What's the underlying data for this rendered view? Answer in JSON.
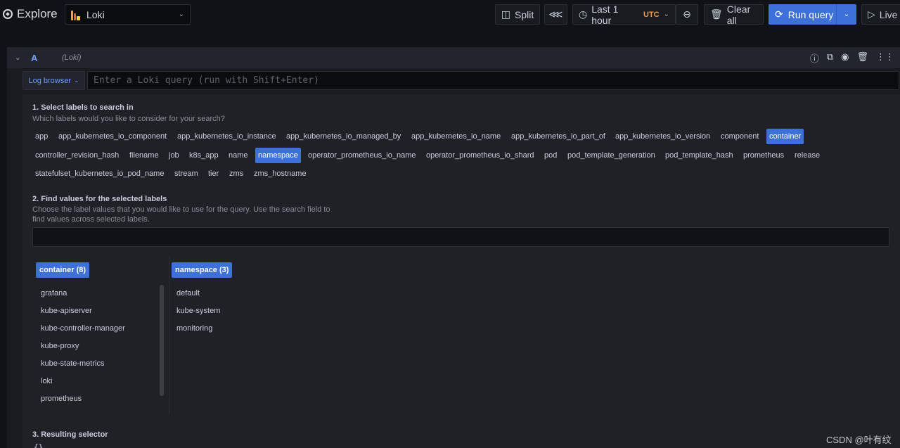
{
  "header": {
    "title": "Explore",
    "datasource": "Loki",
    "split_label": "Split",
    "time_range": "Last 1 hour",
    "timezone": "UTC",
    "clear_label": "Clear all",
    "run_label": "Run query",
    "live_label": "Live"
  },
  "query": {
    "ref_id": "A",
    "datasource_tag": "(Loki)",
    "log_browser_label": "Log browser",
    "placeholder": "Enter a Loki query (run with Shift+Enter)"
  },
  "step1": {
    "title": "1. Select labels to search in",
    "desc": "Which labels would you like to consider for your search?",
    "labels": [
      {
        "text": "app",
        "selected": false
      },
      {
        "text": "app_kubernetes_io_component",
        "selected": false
      },
      {
        "text": "app_kubernetes_io_instance",
        "selected": false
      },
      {
        "text": "app_kubernetes_io_managed_by",
        "selected": false
      },
      {
        "text": "app_kubernetes_io_name",
        "selected": false
      },
      {
        "text": "app_kubernetes_io_part_of",
        "selected": false
      },
      {
        "text": "app_kubernetes_io_version",
        "selected": false
      },
      {
        "text": "component",
        "selected": false
      },
      {
        "text": "container",
        "selected": true
      },
      {
        "text": "controller_revision_hash",
        "selected": false
      },
      {
        "text": "filename",
        "selected": false
      },
      {
        "text": "job",
        "selected": false
      },
      {
        "text": "k8s_app",
        "selected": false
      },
      {
        "text": "name",
        "selected": false
      },
      {
        "text": "namespace",
        "selected": true
      },
      {
        "text": "operator_prometheus_io_name",
        "selected": false
      },
      {
        "text": "operator_prometheus_io_shard",
        "selected": false
      },
      {
        "text": "pod",
        "selected": false
      },
      {
        "text": "pod_template_generation",
        "selected": false
      },
      {
        "text": "pod_template_hash",
        "selected": false
      },
      {
        "text": "prometheus",
        "selected": false
      },
      {
        "text": "release",
        "selected": false
      },
      {
        "text": "statefulset_kubernetes_io_pod_name",
        "selected": false
      },
      {
        "text": "stream",
        "selected": false
      },
      {
        "text": "tier",
        "selected": false
      },
      {
        "text": "zms",
        "selected": false
      },
      {
        "text": "zms_hostname",
        "selected": false
      }
    ]
  },
  "step2": {
    "title": "2. Find values for the selected labels",
    "desc_line1": "Choose the label values that you would like to use for the query. Use the search field to",
    "desc_line2": "find values across selected labels.",
    "columns": [
      {
        "header": "container (8)",
        "values": [
          "grafana",
          "kube-apiserver",
          "kube-controller-manager",
          "kube-proxy",
          "kube-state-metrics",
          "loki",
          "prometheus"
        ]
      },
      {
        "header": "namespace (3)",
        "values": [
          "default",
          "kube-system",
          "monitoring"
        ]
      }
    ]
  },
  "step3": {
    "title": "3. Resulting selector",
    "selector": "{}"
  },
  "watermark": "CSDN @叶有纹"
}
